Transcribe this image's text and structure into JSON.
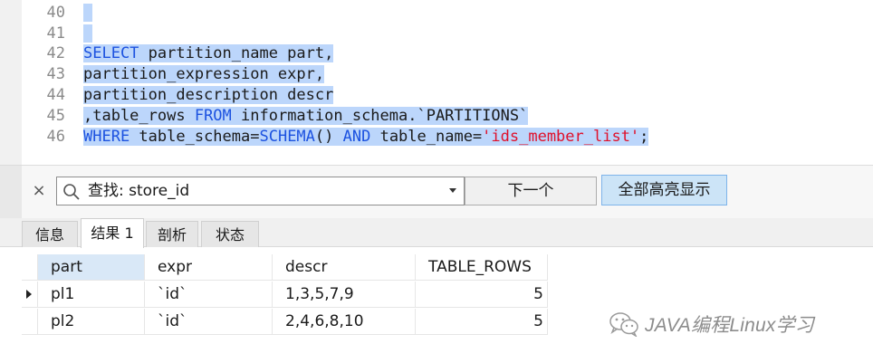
{
  "editor": {
    "lines": [
      {
        "num": "40",
        "tokens": []
      },
      {
        "num": "41",
        "tokens": []
      },
      {
        "num": "42",
        "tokens": [
          {
            "t": "SELECT",
            "k": "kw"
          },
          {
            "t": " partition_name part,",
            "k": ""
          }
        ]
      },
      {
        "num": "43",
        "tokens": [
          {
            "t": "partition_expression expr,",
            "k": ""
          }
        ]
      },
      {
        "num": "44",
        "tokens": [
          {
            "t": "partition_description descr",
            "k": ""
          }
        ]
      },
      {
        "num": "45",
        "tokens": [
          {
            "t": ",table_rows ",
            "k": ""
          },
          {
            "t": "FROM",
            "k": "kw"
          },
          {
            "t": " information_schema.`PARTITIONS`",
            "k": ""
          }
        ]
      },
      {
        "num": "46",
        "tokens": [
          {
            "t": "WHERE",
            "k": "kw"
          },
          {
            "t": " table_schema=",
            "k": ""
          },
          {
            "t": "SCHEMA",
            "k": "kw"
          },
          {
            "t": "() ",
            "k": ""
          },
          {
            "t": "AND",
            "k": "kw"
          },
          {
            "t": " table_name=",
            "k": ""
          },
          {
            "t": "'ids_member_list'",
            "k": "str"
          },
          {
            "t": ";",
            "k": ""
          }
        ]
      }
    ],
    "selection_color": "#bcd6fb",
    "keyword_color": "#1c52e0",
    "string_color": "#e0102a"
  },
  "find": {
    "close_icon": "close-icon",
    "search_icon": "search-icon",
    "text": "查找: store_id",
    "next_label": "下一个",
    "highlight_all_label": "全部高亮显示"
  },
  "tabs": [
    {
      "label": "信息",
      "active": false
    },
    {
      "label": "结果 1",
      "active": true
    },
    {
      "label": "剖析",
      "active": false
    },
    {
      "label": "状态",
      "active": false
    }
  ],
  "grid": {
    "columns": [
      "part",
      "expr",
      "descr",
      "TABLE_ROWS"
    ],
    "rows": [
      {
        "part": "pl1",
        "expr": "`id`",
        "descr": "1,3,5,7,9",
        "table_rows": "5",
        "current": true
      },
      {
        "part": "pl2",
        "expr": "`id`",
        "descr": "2,4,6,8,10",
        "table_rows": "5",
        "current": false
      }
    ]
  },
  "watermark": {
    "icon": "wechat-icon",
    "text": "JAVA编程Linux学习"
  }
}
